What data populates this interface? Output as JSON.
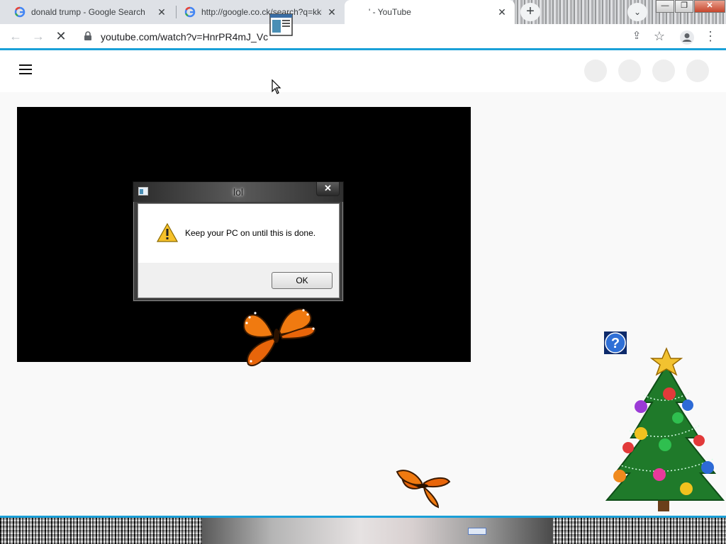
{
  "browser": {
    "tabs": [
      {
        "title": "donald trump - Google Search",
        "active": false
      },
      {
        "title": "http://google.co.ck/search?q=kkk",
        "active": false
      },
      {
        "title": "' - YouTube",
        "active": true
      }
    ],
    "new_tab_label": "+",
    "tab_search_label": "⌄",
    "window_controls": {
      "minimize": "—",
      "restore": "❐",
      "close": "✕"
    },
    "address": "youtube.com/watch?v=HnrPR4mJ_Vc",
    "nav": {
      "back": "←",
      "forward": "→",
      "stop": "✕"
    },
    "toolbar_icons": {
      "share": "⇪",
      "bookmark": "☆",
      "menu": "⋮"
    }
  },
  "dialog": {
    "title": "lol",
    "close_label": "✕",
    "message": "Keep your PC on until this is done.",
    "ok_label": "OK",
    "icon": "warning-icon"
  },
  "colors": {
    "accent_bar": "#1aa0d8",
    "video_bg": "#000000",
    "page_bg": "#f9f9f9"
  }
}
